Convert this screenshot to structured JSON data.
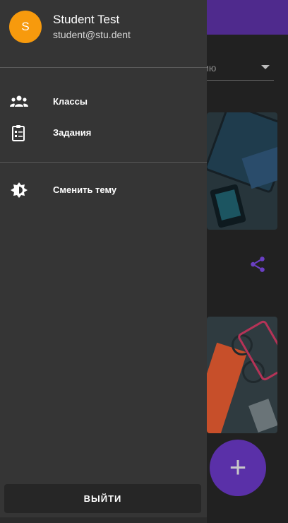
{
  "background": {
    "sort_text": "ию",
    "colors": {
      "appbar": "#4f2a8d",
      "fab": "#5a30a8",
      "share": "#6a3fc4"
    }
  },
  "drawer": {
    "avatar_letter": "S",
    "user_name": "Student Test",
    "user_email": "student@stu.dent",
    "items": [
      {
        "label": "Классы",
        "icon": "people-icon"
      },
      {
        "label": "Задания",
        "icon": "assignment-icon"
      },
      {
        "label": "Сменить тему",
        "icon": "brightness-icon"
      }
    ],
    "logout_label": "ВЫЙТИ",
    "colors": {
      "avatar": "#f79a0d",
      "surface": "#353535"
    }
  }
}
